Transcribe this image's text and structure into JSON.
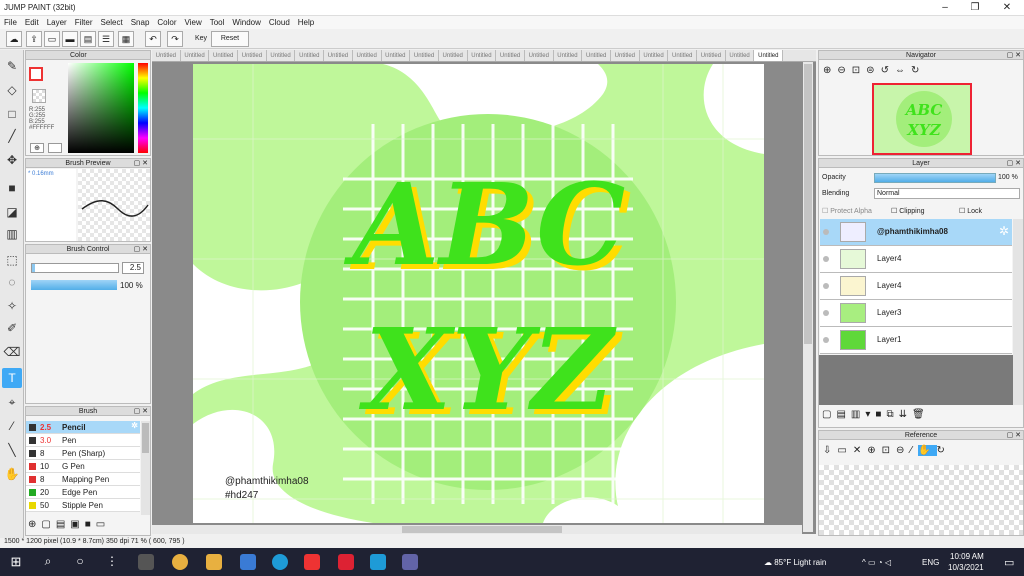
{
  "window": {
    "title": "JUMP PAINT (32bit)"
  },
  "menu": [
    "File",
    "Edit",
    "Layer",
    "Filter",
    "Select",
    "Snap",
    "Color",
    "View",
    "Tool",
    "Window",
    "Cloud",
    "Help"
  ],
  "toolbar": {
    "key_label": "Key",
    "reset_label": "Reset"
  },
  "tabs": [
    "Untitled",
    "Untitled",
    "Untitled",
    "Untitled",
    "Untitled",
    "Untitled",
    "Untitled",
    "Untitled",
    "Untitled",
    "Untitled",
    "Untitled",
    "Untitled",
    "Untitled",
    "Untitled",
    "Untitled",
    "Untitled",
    "Untitled",
    "Untitled",
    "Untitled",
    "Untitled",
    "Untitled",
    "Untitled"
  ],
  "color_panel": {
    "title": "Color",
    "r": "R:255",
    "g": "G:255",
    "b": "B:255",
    "hex": "#FFFFFF"
  },
  "brush_preview": {
    "title": "Brush Preview",
    "size": "* 0.16mm"
  },
  "brush_control": {
    "title": "Brush Control",
    "size": "2.5",
    "opacity": "100 %"
  },
  "brush_panel": {
    "title": "Brush",
    "items": [
      {
        "size": "2.5",
        "name": "Pencil",
        "color": "#333333"
      },
      {
        "size": "3.0",
        "name": "Pen",
        "color": "#333333"
      },
      {
        "size": "8",
        "name": "Pen (Sharp)",
        "color": "#333333"
      },
      {
        "size": "10",
        "name": "G Pen",
        "color": "#e03030"
      },
      {
        "size": "8",
        "name": "Mapping Pen",
        "color": "#e03030"
      },
      {
        "size": "20",
        "name": "Edge Pen",
        "color": "#22aa22"
      },
      {
        "size": "50",
        "name": "Stipple Pen",
        "color": "#e8d800"
      }
    ]
  },
  "artwork": {
    "line1": "ABC",
    "line2": "XYZ",
    "handle": "@phamthikimha08",
    "tag": "#hd247"
  },
  "navigator": {
    "title": "Navigator"
  },
  "layer_panel": {
    "title": "Layer",
    "opacity_label": "Opacity",
    "opacity_value": "100 %",
    "blending_label": "Blending",
    "blending_value": "Normal",
    "protect_alpha": "Protect Alpha",
    "clipping": "Clipping",
    "lock": "Lock",
    "layers": [
      "@phamthikimha08",
      "Layer4",
      "Layer4",
      "Layer3",
      "Layer1"
    ]
  },
  "reference": {
    "title": "Reference"
  },
  "status": {
    "text": "1500 * 1200 pixel  (10.9 * 8.7cm)  350 dpi  71 %  ( 600, 795 )"
  },
  "taskbar": {
    "weather": "85°F  Light rain",
    "lang": "ENG",
    "time": "10:09 AM",
    "date": "10/3/2021"
  }
}
